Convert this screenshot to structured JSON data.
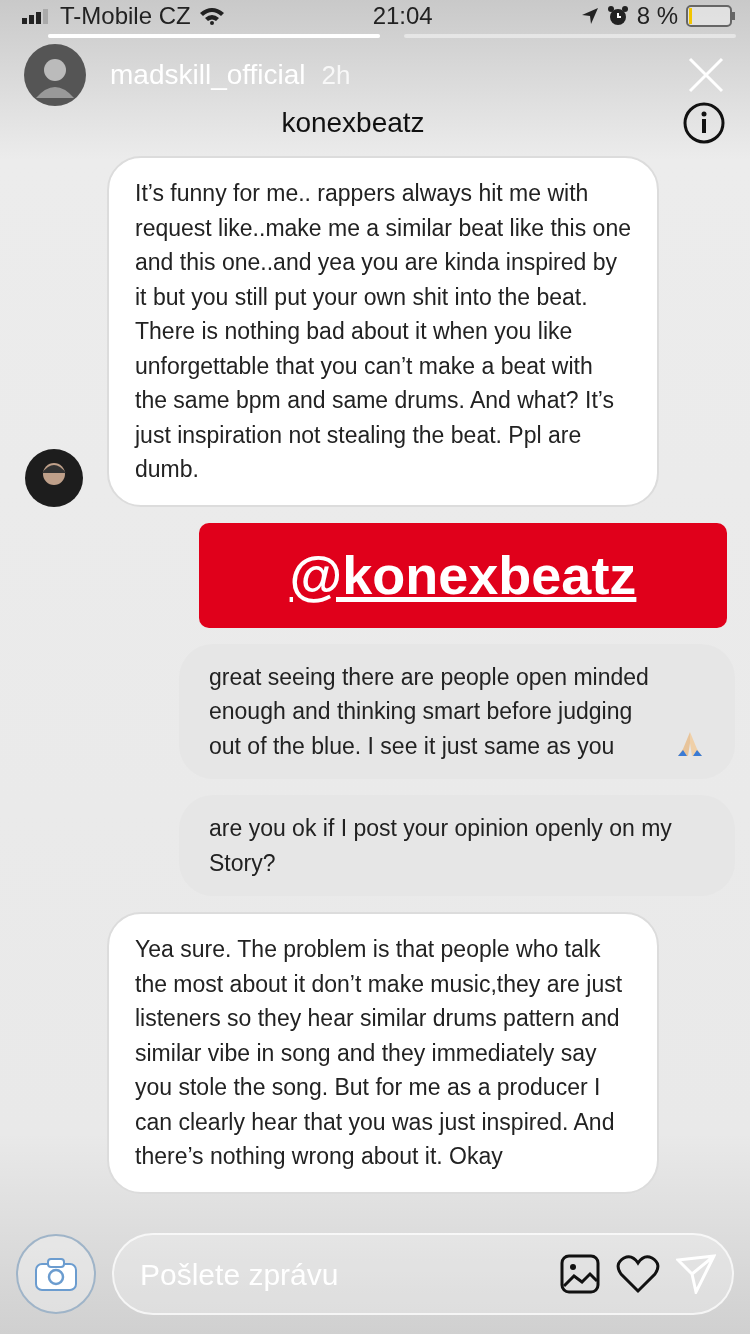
{
  "status_bar": {
    "carrier": "T-Mobile CZ",
    "time": "21:04",
    "battery": "8 %"
  },
  "story": {
    "progress": [
      {
        "level": 1
      },
      {
        "level": 0
      }
    ],
    "username": "madskill_official",
    "age": "2h"
  },
  "chat": {
    "title": "konexbeatz",
    "messages": [
      {
        "kind": "received",
        "avatar": true,
        "text": "It’s funny for me.. rappers always hit me with request like..make me a similar beat like this one and this one..and yea you are kinda inspired by it but you still put your own shit into the beat. There is nothing bad about it when you like unforgettable that you can’t make a beat with the same bpm and same drums. And what? It’s just inspiration not stealing the beat. Ppl are dumb."
      },
      {
        "kind": "mention",
        "text": "@konexbeatz"
      },
      {
        "kind": "sent_with_emoji",
        "text": "great seeing there are people open minded enough and thinking smart before judging out of the blue. I see it just same as you"
      },
      {
        "kind": "sent",
        "text": "are you ok if I post your opinion openly on my Story?"
      },
      {
        "kind": "received",
        "avatar": false,
        "text": "Yea sure. The problem is that people who talk the most about it don’t make music,they are just listeners so they hear similar drums pattern and similar vibe in song and they immediately say you stole the song. But for me as a producer I can clearly hear that you was just inspired. And there’s nothing wrong about it. Okay"
      }
    ]
  },
  "composer": {
    "placeholder": "Pošlete zprávu"
  }
}
